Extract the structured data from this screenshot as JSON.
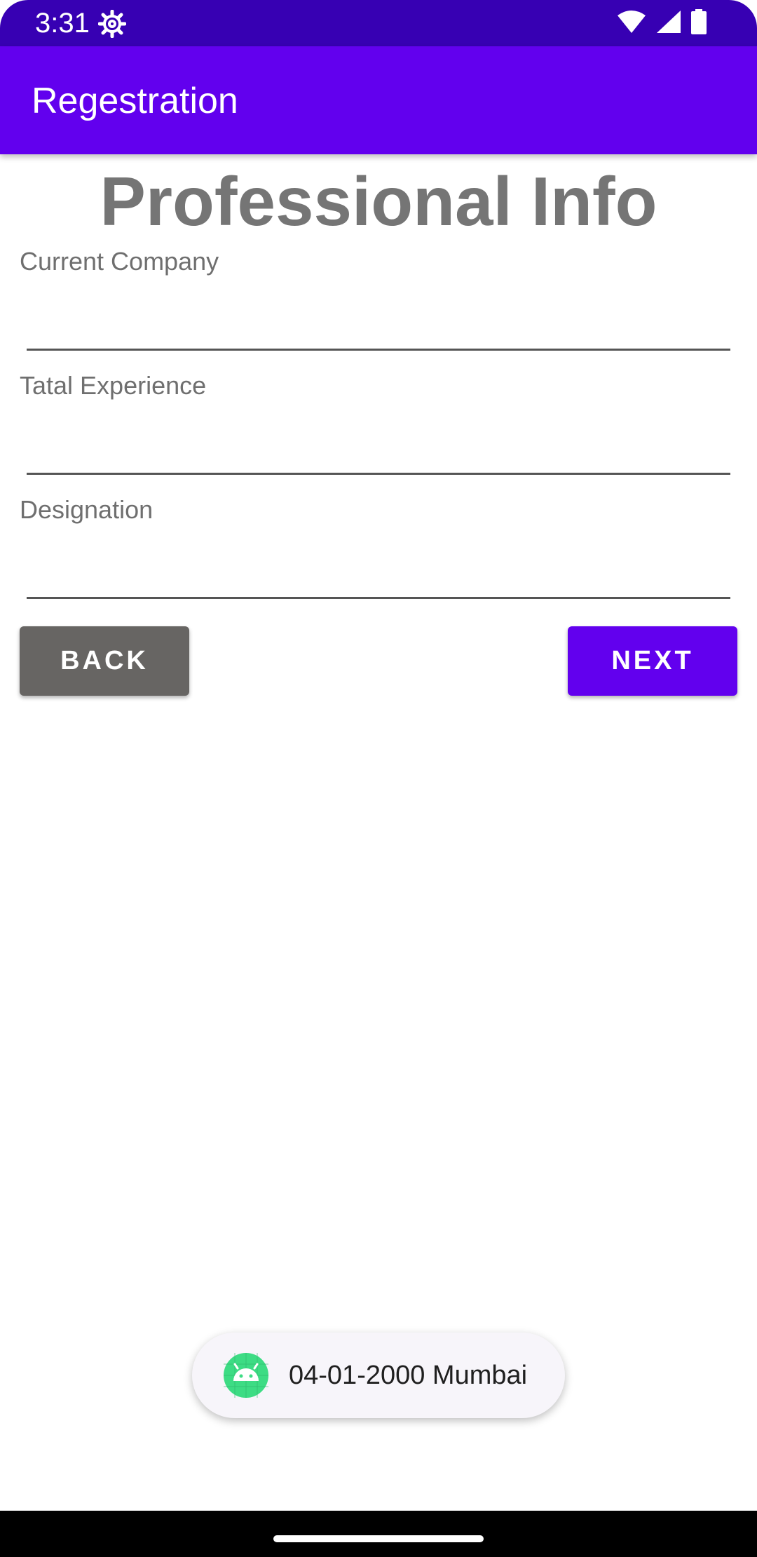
{
  "status_bar": {
    "time": "3:31",
    "icons": [
      "settings-gear-icon",
      "wifi-icon",
      "cellular-signal-icon",
      "battery-icon"
    ],
    "background": "#3700B3"
  },
  "app_bar": {
    "title": "Regestration",
    "background": "#6200EE"
  },
  "page": {
    "heading": "Professional Info"
  },
  "form": {
    "fields": [
      {
        "label": "Current Company",
        "value": ""
      },
      {
        "label": "Tatal Experience",
        "value": ""
      },
      {
        "label": "Designation",
        "value": ""
      }
    ]
  },
  "buttons": {
    "back_label": "BACK",
    "back_color": "#676563",
    "next_label": "NEXT",
    "next_color": "#6200EE"
  },
  "toast": {
    "icon": "android-icon",
    "text": "04-01-2000 Mumbai"
  },
  "nav_bar": {
    "background": "#000000"
  }
}
